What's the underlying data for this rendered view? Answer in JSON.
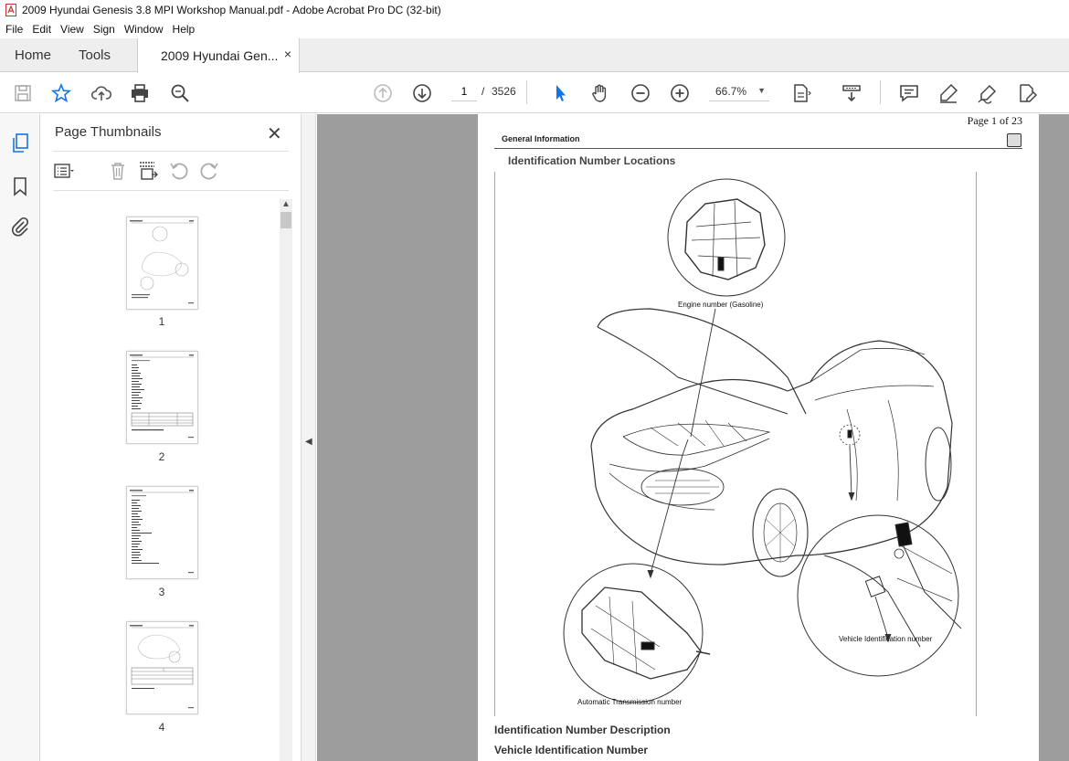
{
  "window": {
    "title": "2009 Hyundai Genesis 3.8 MPI Workshop Manual.pdf - Adobe Acrobat Pro DC (32-bit)"
  },
  "menu": [
    "File",
    "Edit",
    "View",
    "Sign",
    "Window",
    "Help"
  ],
  "tabs": {
    "home": "Home",
    "tools": "Tools",
    "document": "2009 Hyundai Gen...",
    "close_glyph": "×"
  },
  "toolbar": {
    "icons": [
      "save-icon",
      "star-icon",
      "upload-icon",
      "print-icon",
      "zoom-search-icon",
      "page-up-icon",
      "page-down-icon",
      "select-arrow-icon",
      "hand-icon",
      "zoom-out-icon",
      "zoom-in-icon",
      "fit-page-icon",
      "scroll-mode-icon",
      "comment-icon",
      "highlight-icon",
      "sign-icon",
      "edit-text-icon"
    ],
    "current_page": "1",
    "page_separator": "/",
    "total_pages": "3526",
    "zoom": "66.7%"
  },
  "left_panel": {
    "title": "Page Thumbnails",
    "close_glyph": "✕",
    "thumbnails": [
      {
        "label": "1"
      },
      {
        "label": "2"
      },
      {
        "label": "3"
      },
      {
        "label": "4"
      }
    ]
  },
  "document": {
    "page_count": "Page 1 of 23",
    "section": "General Information",
    "heading": "Identification Number Locations",
    "figure_labels": {
      "engine": "Engine number (Gasoline)",
      "vin": "Vehicle Identification number",
      "transmission": "Automatic Transmission number"
    },
    "heading_description": "Identification Number Description",
    "heading_vin": "Vehicle Identification Number"
  },
  "colors": {
    "accent": "#1473e6",
    "doc_background": "#9d9d9d"
  }
}
